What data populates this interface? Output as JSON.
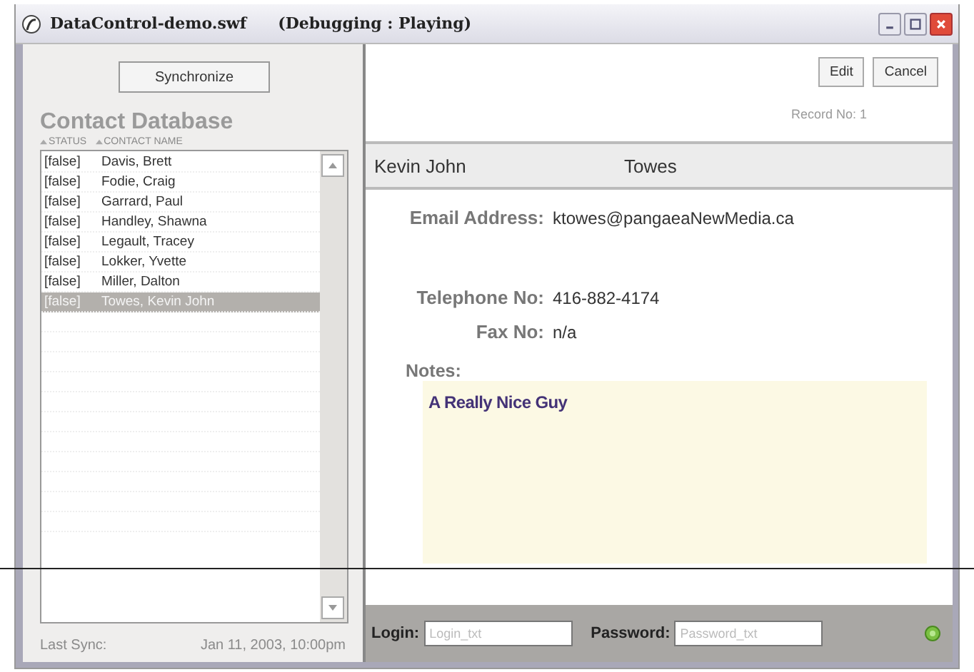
{
  "window": {
    "title": "DataControl-demo.swf",
    "status": "(Debugging : Playing)"
  },
  "sidebar": {
    "sync_button": "Synchronize",
    "heading": "Contact Database",
    "columns": [
      "STATUS",
      "CONTACT NAME"
    ],
    "contacts": [
      {
        "status": "[false]",
        "name": "Davis, Brett",
        "selected": false
      },
      {
        "status": "[false]",
        "name": "Fodie, Craig",
        "selected": false
      },
      {
        "status": "[false]",
        "name": "Garrard, Paul",
        "selected": false
      },
      {
        "status": "[false]",
        "name": "Handley, Shawna",
        "selected": false
      },
      {
        "status": "[false]",
        "name": "Legault, Tracey",
        "selected": false
      },
      {
        "status": "[false]",
        "name": "Lokker, Yvette",
        "selected": false
      },
      {
        "status": "[false]",
        "name": "Miller, Dalton",
        "selected": false
      },
      {
        "status": "[false]",
        "name": "Towes, Kevin John",
        "selected": true
      }
    ],
    "last_sync": {
      "label": "Last Sync:",
      "value": "Jan 11, 2003, 10:00pm"
    }
  },
  "detail": {
    "buttons": [
      "Edit",
      "Cancel"
    ],
    "record": "Record No:  1",
    "first_name": "Kevin John",
    "last_name": "Towes",
    "fields": [
      {
        "label": "Email Address:",
        "value": "ktowes@pangaeaNewMedia.ca"
      },
      {
        "label": "Telephone No:",
        "value": "416-882-4174"
      },
      {
        "label": "Fax No:",
        "value": "n/a"
      }
    ],
    "notes": {
      "label": "Notes:",
      "text": "A Really Nice Guy"
    }
  },
  "login_bar": {
    "login": {
      "label": "Login:",
      "placeholder": "Login_txt"
    },
    "password": {
      "label": "Password:",
      "placeholder": "Password_txt"
    }
  }
}
